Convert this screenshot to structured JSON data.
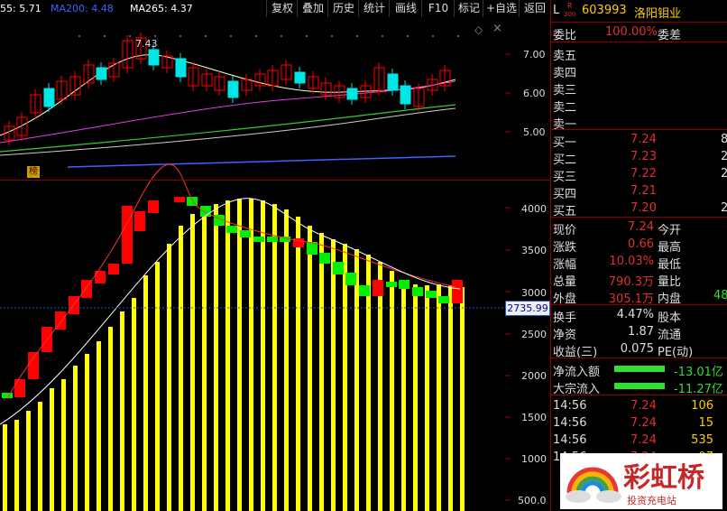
{
  "ma_legend": {
    "ma55": "55: 5.71",
    "ma200": "MA200: 4.48",
    "ma265": "MA265: 4.37"
  },
  "toolbar": {
    "buttons": [
      "复权",
      "叠加",
      "历史",
      "统计",
      "画线",
      "F10",
      "标记",
      "+自选",
      "返回"
    ]
  },
  "price_axis": [
    "7.00",
    "6.00",
    "5.00"
  ],
  "volume_axis": [
    "4000",
    "3500",
    "3000",
    "2500",
    "2000",
    "1500",
    "1000",
    "500.0"
  ],
  "high_marker": "7.43",
  "current_marker": "2735.99",
  "icons": {
    "bang": "榜"
  },
  "stock": {
    "prefix": "L",
    "badge_top": "R",
    "badge_bottom": "300",
    "code": "603993",
    "name": "洛阳钼业"
  },
  "weibi": {
    "label1": "委比",
    "value1": "100.00%",
    "label2": "委差",
    "value2": ""
  },
  "sell": [
    {
      "label": "卖五",
      "price": "",
      "vol": ""
    },
    {
      "label": "卖四",
      "price": "",
      "vol": ""
    },
    {
      "label": "卖三",
      "price": "",
      "vol": ""
    },
    {
      "label": "卖二",
      "price": "",
      "vol": ""
    },
    {
      "label": "卖一",
      "price": "",
      "vol": ""
    }
  ],
  "buy": [
    {
      "label": "买一",
      "price": "7.24",
      "vol": "8"
    },
    {
      "label": "买二",
      "price": "7.23",
      "vol": "2"
    },
    {
      "label": "买三",
      "price": "7.22",
      "vol": "2"
    },
    {
      "label": "买四",
      "price": "7.21",
      "vol": ""
    },
    {
      "label": "买五",
      "price": "7.20",
      "vol": "2"
    }
  ],
  "quote": [
    {
      "l1": "现价",
      "v1": "7.24",
      "l2": "今开",
      "v2": ""
    },
    {
      "l1": "涨跌",
      "v1": "0.66",
      "l2": "最高",
      "v2": ""
    },
    {
      "l1": "涨幅",
      "v1": "10.03%",
      "l2": "最低",
      "v2": ""
    },
    {
      "l1": "总量",
      "v1": "790.3万",
      "l2": "量比",
      "v2": ""
    },
    {
      "l1": "外盘",
      "v1": "305.1万",
      "l2": "内盘",
      "v2": "48"
    }
  ],
  "stats": [
    {
      "l1": "换手",
      "v1": "4.47%",
      "l2": "股本",
      "v2": ""
    },
    {
      "l1": "净资",
      "v1": "1.87",
      "l2": "流通",
      "v2": ""
    },
    {
      "l1": "收益(三)",
      "v1": "0.075",
      "l2": "PE(动)",
      "v2": ""
    }
  ],
  "flows": [
    {
      "label": "净流入额",
      "value": "-13.01亿",
      "fill": 1.0
    },
    {
      "label": "大宗流入",
      "value": "-11.27亿",
      "fill": 1.0
    }
  ],
  "trades": [
    {
      "time": "14:56",
      "price": "7.24",
      "vol": "106"
    },
    {
      "time": "14:56",
      "price": "7.24",
      "vol": "15"
    },
    {
      "time": "14:56",
      "price": "7.24",
      "vol": "535"
    },
    {
      "time": "14:56",
      "price": "7.24",
      "vol": "97"
    }
  ],
  "logo": {
    "text": "彩虹桥",
    "tagline": "投资充电站"
  },
  "colors": {
    "up": "#ff0000",
    "down": "#00e5e5",
    "vol_bar": "#ffff00",
    "flow_bar": "#33dd33",
    "green_block": "#00ee00"
  }
}
